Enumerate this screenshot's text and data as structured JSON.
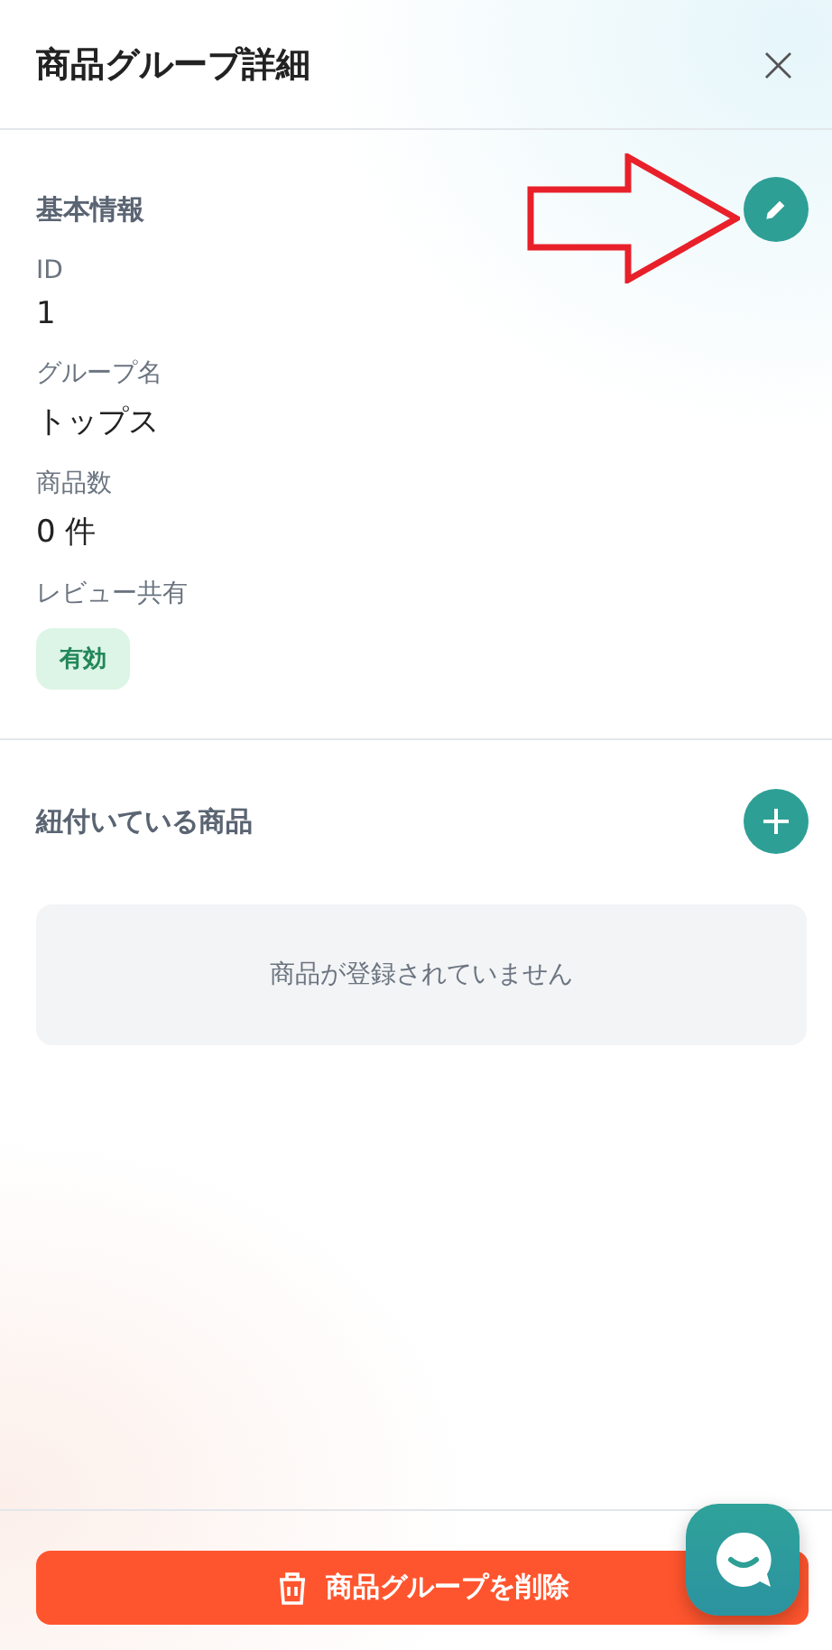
{
  "header": {
    "title": "商品グループ詳細",
    "close": "×"
  },
  "basic_info": {
    "heading": "基本情報",
    "fields": [
      {
        "label": "ID",
        "value": "1",
        "kind": "text"
      },
      {
        "label": "グループ名",
        "value": "トップス",
        "kind": "text"
      },
      {
        "label": "商品数",
        "value": "0 件",
        "kind": "text"
      },
      {
        "label": "レビュー共有",
        "value": "有効",
        "kind": "badge"
      }
    ]
  },
  "linked_products": {
    "heading": "紐付いている商品",
    "empty_message": "商品が登録されていません"
  },
  "footer": {
    "delete_button": "商品グループを削除"
  }
}
